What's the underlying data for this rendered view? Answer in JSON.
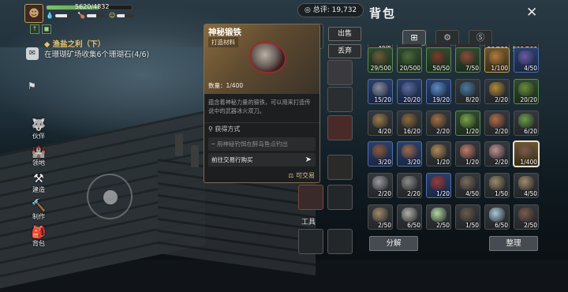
{
  "hud": {
    "hp_text": "5620/4832",
    "hp_fraction": 0.62,
    "stamina_fraction": 0.7,
    "hunger_fraction": 0.55,
    "mood_fraction": 0.45,
    "buffs": [
      "↑",
      "◼"
    ]
  },
  "quest": {
    "title": "渔盐之利（下）",
    "desc": "在珊瑚矿场收集6个珊瑚石(4/6)"
  },
  "sidenav": [
    {
      "label": "伙伴",
      "icon": "wolf-icon"
    },
    {
      "label": "领地",
      "icon": "castle-icon"
    },
    {
      "label": "建造",
      "icon": "hammer-icon"
    },
    {
      "label": "制作",
      "icon": "anvil-icon"
    },
    {
      "label": "背包",
      "icon": "backpack-icon"
    }
  ],
  "currency": {
    "label": "总评",
    "value": "19,732"
  },
  "detail": {
    "name": "神秘锻铁",
    "category": "打造材料",
    "quantity": "数量：1/400",
    "description": "蕴含着神秘力量的锻铁，可以用来打造传说中的武器冰火双刀。",
    "source_header": "获得方式",
    "source_1": "用神秘钓饵在醉岛鱼点钓出",
    "source_2": "前往交易行购买",
    "tradable": "可交易",
    "sell": "出售",
    "discard": "丢弃"
  },
  "tools_label": "工具",
  "backpack": {
    "title": "背包",
    "tabs": [
      "all-icon",
      "gear-icon",
      "coin-icon"
    ],
    "partial_row": [
      "40级",
      "",
      "",
      "",
      "50/500",
      "500/500"
    ],
    "slots": [
      {
        "c": "29/500",
        "r": "green",
        "col": "#6b5a3a"
      },
      {
        "c": "20/500",
        "r": "green",
        "col": "#4a6a3a"
      },
      {
        "c": "50/50",
        "r": "green",
        "col": "#7a3a2a"
      },
      {
        "c": "7/50",
        "r": "green",
        "col": "#8a4a3a"
      },
      {
        "c": "1/100",
        "r": "gold",
        "col": "#b07a3a"
      },
      {
        "c": "4/50",
        "r": "blue",
        "col": "#6a5aa0"
      },
      {
        "c": "15/20",
        "r": "blue",
        "col": "#8a8a9a"
      },
      {
        "c": "20/20",
        "r": "blue",
        "col": "#5a6a9a"
      },
      {
        "c": "19/20",
        "r": "blue",
        "col": "#5a8ac0"
      },
      {
        "c": "8/20",
        "r": "gray",
        "col": "#4a7aa0"
      },
      {
        "c": "2/20",
        "r": "gray",
        "col": "#b08a3a"
      },
      {
        "c": "20/20",
        "r": "green",
        "col": "#6a8a3a"
      },
      {
        "c": "4/20",
        "r": "gray",
        "col": "#9a7a4a"
      },
      {
        "c": "16/20",
        "r": "gray",
        "col": "#8a6a3a"
      },
      {
        "c": "2/20",
        "r": "gray",
        "col": "#a07040"
      },
      {
        "c": "1/20",
        "r": "green",
        "col": "#7aa04a"
      },
      {
        "c": "2/20",
        "r": "gray",
        "col": "#b06a4a"
      },
      {
        "c": "6/20",
        "r": "gray",
        "col": "#6a9a4a"
      },
      {
        "c": "3/20",
        "r": "blue",
        "col": "#8a5a3a"
      },
      {
        "c": "3/20",
        "r": "blue",
        "col": "#9a6a4a"
      },
      {
        "c": "1/20",
        "r": "gray",
        "col": "#b08a5a"
      },
      {
        "c": "1/20",
        "r": "gray",
        "col": "#c07a6a"
      },
      {
        "c": "2/20",
        "r": "gray",
        "col": "#c09090"
      },
      {
        "c": "1/400",
        "r": "gold",
        "col": "#7a5a4a",
        "sel": true
      },
      {
        "c": "2/20",
        "r": "gray",
        "col": "#9a9aa0"
      },
      {
        "c": "2/20",
        "r": "gray",
        "col": "#8a8a8a"
      },
      {
        "c": "1/20",
        "r": "blue",
        "col": "#9a3a3a"
      },
      {
        "c": "4/50",
        "r": "gray",
        "col": "#7a6a5a"
      },
      {
        "c": "1/50",
        "r": "gray",
        "col": "#9a8a6a"
      },
      {
        "c": "4/50",
        "r": "gray",
        "col": "#a08a6a"
      },
      {
        "c": "2/50",
        "r": "gray",
        "col": "#a08a6a"
      },
      {
        "c": "6/50",
        "r": "gray",
        "col": "#b0b0a8"
      },
      {
        "c": "2/50",
        "r": "gray",
        "col": "#b0d8a0"
      },
      {
        "c": "1/50",
        "r": "gray",
        "col": "#6a5a4a"
      },
      {
        "c": "6/50",
        "r": "gray",
        "col": "#a8c8d8"
      },
      {
        "c": "2/50",
        "r": "gray",
        "col": "#7a5a4a"
      }
    ],
    "split": "分解",
    "sort": "整理"
  },
  "left_items": [
    "red-gear",
    "pink-item",
    "hammer",
    "scythe-item",
    "axe",
    "sword",
    "pickaxe",
    "spear",
    "rake",
    "shovel"
  ]
}
